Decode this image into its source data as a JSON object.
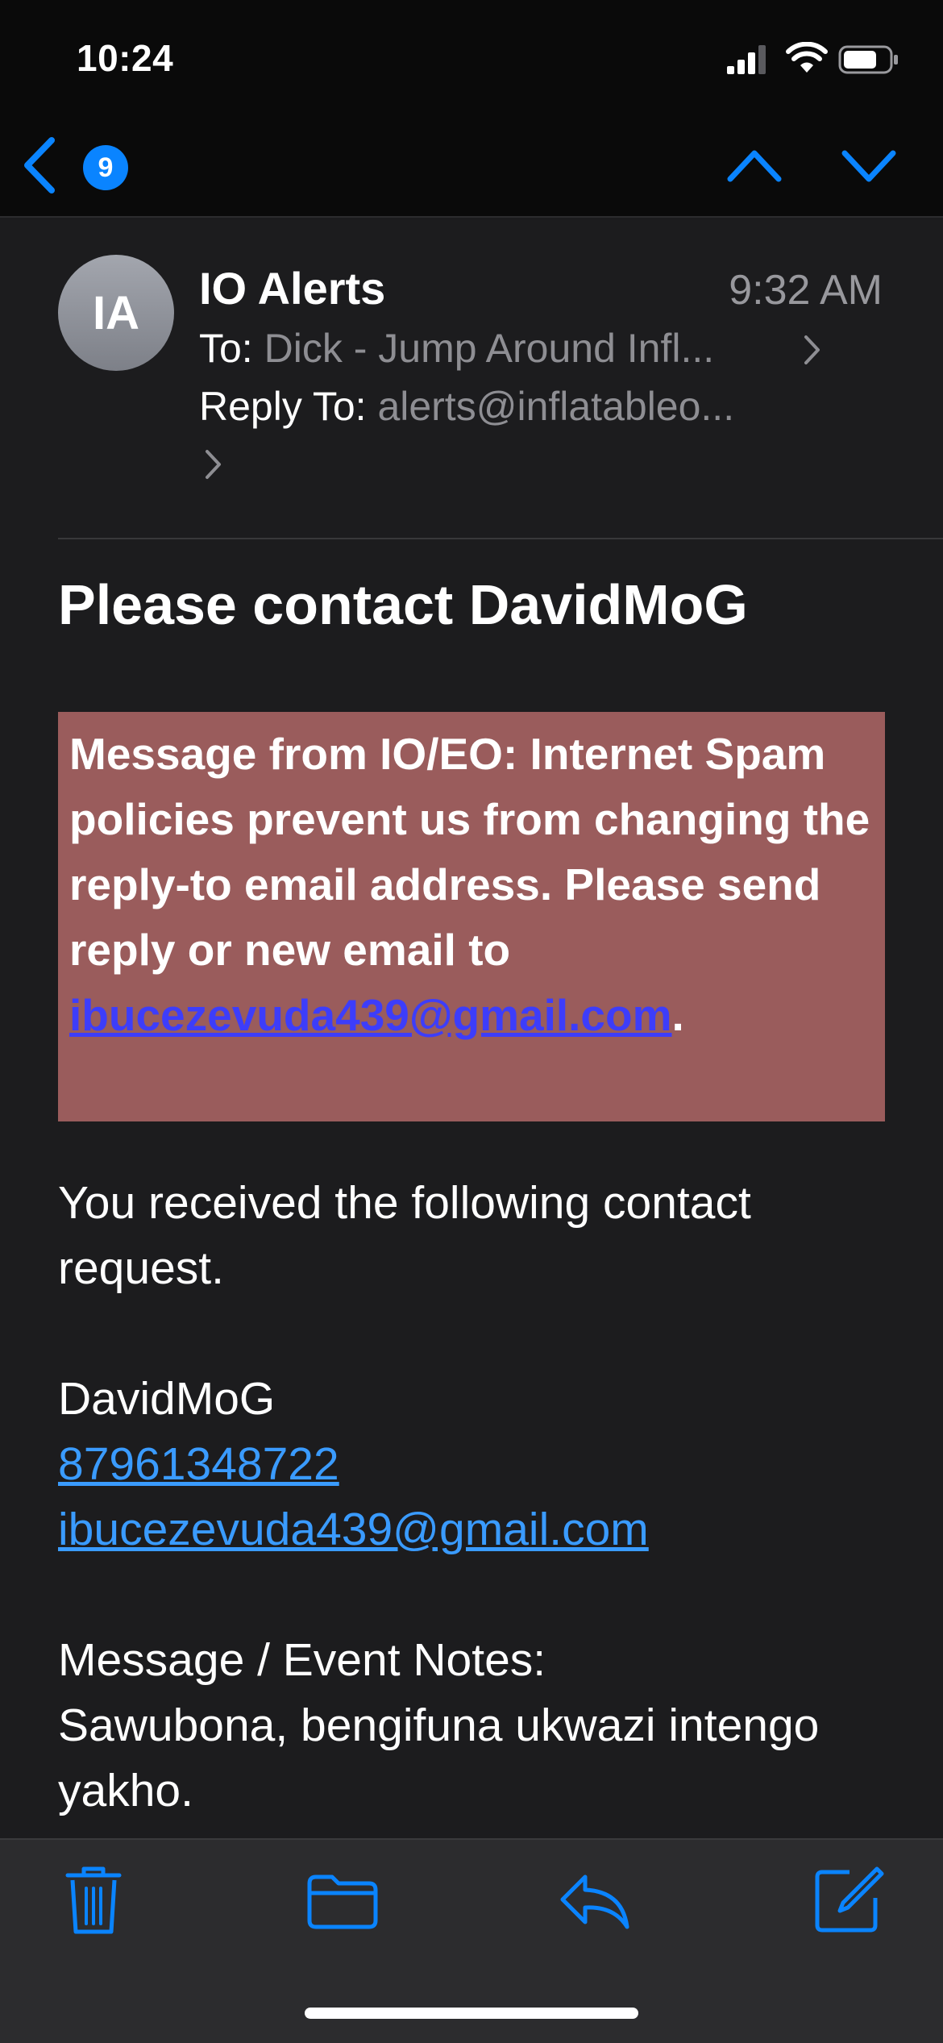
{
  "status_bar": {
    "time": "10:24"
  },
  "nav": {
    "unread_count": "9"
  },
  "header": {
    "avatar_initials": "IA",
    "sender": "IO Alerts",
    "time": "9:32 AM",
    "to_label": "To:",
    "to_value": "Dick - Jump Around Infl...",
    "reply_label": "Reply To:",
    "reply_value": "alerts@inflatableo..."
  },
  "subject": "Please contact DavidMoG",
  "warning": {
    "text": "Message from IO/EO: Internet Spam policies prevent us from changing the reply-to email address. Please send reply or new email to ",
    "email": "ibucezevuda439@gmail.com",
    "suffix": "."
  },
  "body": {
    "intro": "You received the following contact request.",
    "name": "DavidMoG",
    "phone": "87961348722",
    "email": "ibucezevuda439@gmail.com",
    "notes_label": "Message / Event Notes:",
    "notes": "Sawubona, bengifuna ukwazi intengo yakho."
  },
  "colors": {
    "accent": "#0a84ff",
    "warning_bg": "#9a5c5c",
    "background": "#1c1c1e"
  },
  "icons": [
    "back-chevron-icon",
    "chevron-up-icon",
    "chevron-down-icon",
    "trash-icon",
    "folder-icon",
    "reply-icon",
    "compose-icon",
    "signal-icon",
    "wifi-icon",
    "battery-icon"
  ]
}
